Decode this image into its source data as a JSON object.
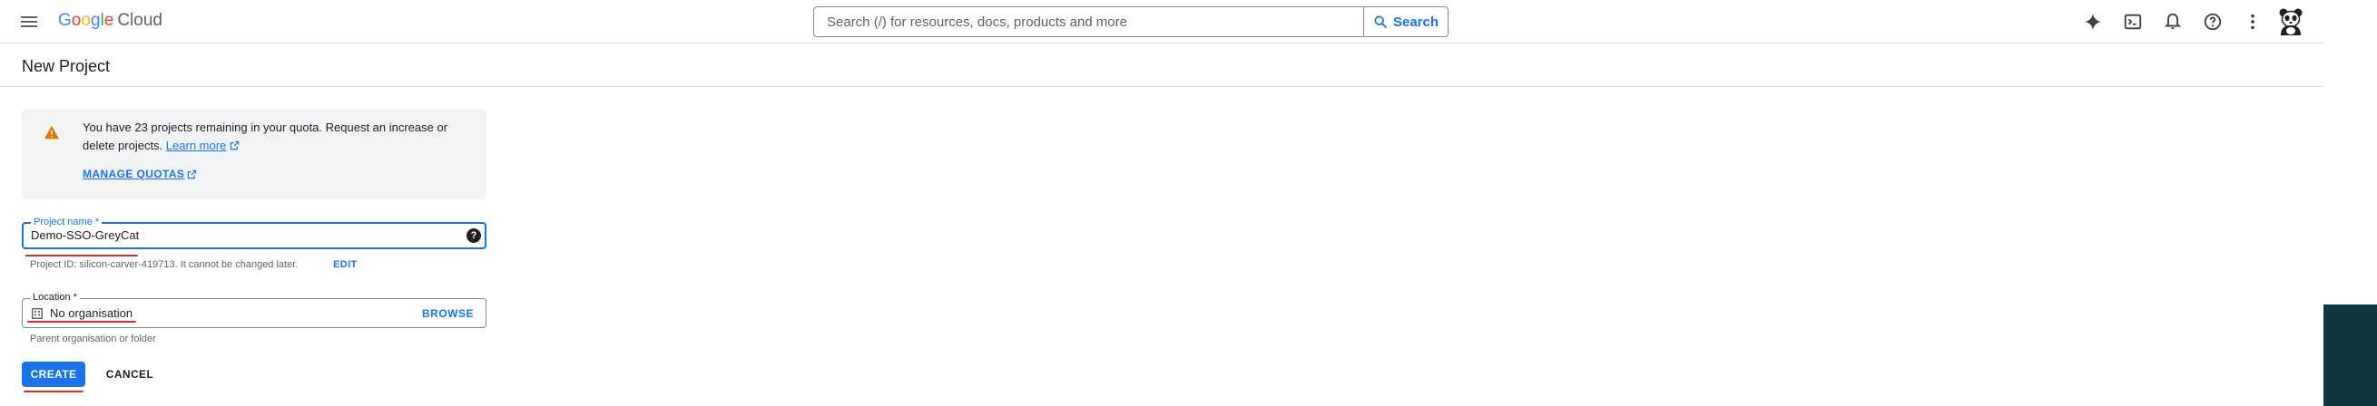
{
  "header": {
    "logo_google": [
      "G",
      "o",
      "o",
      "g",
      "l",
      "e"
    ],
    "logo_cloud": "Cloud",
    "search": {
      "placeholder": "Search (/) for resources, docs, products and more",
      "button_label": "Search"
    },
    "icons": [
      "gemini-sparkle-icon",
      "cloud-shell-icon",
      "notifications-icon",
      "help-icon",
      "more-vert-icon",
      "avatar"
    ]
  },
  "page": {
    "title": "New Project"
  },
  "alert": {
    "text": "You have 23 projects remaining in your quota. Request an increase or delete projects.",
    "learn_more": "Learn more",
    "manage_quotas": "MANAGE QUOTAS"
  },
  "form": {
    "project_name": {
      "label": "Project name *",
      "value": "Demo-SSO-GreyCat",
      "help": "?"
    },
    "project_id_hint": "Project ID: silicon-carver-419713. It cannot be changed later.",
    "edit_label": "EDIT",
    "location": {
      "label": "Location *",
      "value": "No organisation",
      "browse_label": "BROWSE"
    },
    "location_hint": "Parent organisation or folder"
  },
  "actions": {
    "create_label": "CREATE",
    "cancel_label": "CANCEL"
  },
  "colors": {
    "primary": "#1a73e8",
    "warning": "#e37400",
    "annotation": "#d93025"
  }
}
